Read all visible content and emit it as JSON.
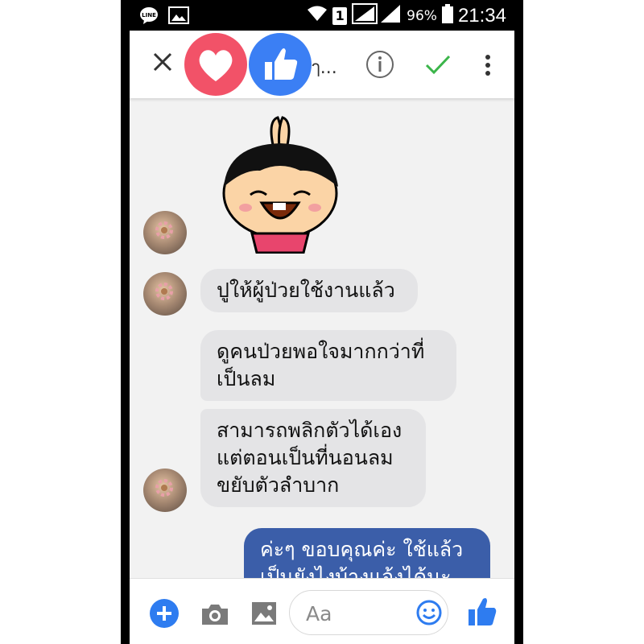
{
  "status_bar": {
    "sim_label": "1",
    "battery": "96%",
    "time": "21:34",
    "icons": [
      "line-app-icon",
      "gallery-notification-icon",
      "wifi-icon",
      "signal-icon",
      "battery-icon"
    ]
  },
  "top_bar": {
    "name_truncated": "ๅ...",
    "icons": [
      "close-icon",
      "heart-reaction-icon",
      "like-reaction-icon",
      "info-icon",
      "check-icon",
      "more-icon"
    ]
  },
  "messages": [
    {
      "from": "other",
      "text": "ปูให้ผู้ป่วยใช้งานแล้ว"
    },
    {
      "from": "other",
      "text": "ดูคนป่วยพอใจมากกว่าที่\nเป็นลม"
    },
    {
      "from": "other",
      "text": "สามารถพลิกตัวได้เอง\nแต่ตอนเป็นที่นอนลม\nขยับตัวลำบาก"
    },
    {
      "from": "me",
      "text": "ค่ะๆ ขอบคุณค่ะ ใช้แล้ว\nเป็นยังไงบ้างแจ้งได้นะ"
    }
  ],
  "composer": {
    "placeholder": "Aa",
    "icons": [
      "plus-icon",
      "camera-icon",
      "gallery-icon",
      "emoji-icon",
      "thumbs-up-icon"
    ]
  },
  "colors": {
    "accent": "#3b7ff4",
    "heart": "#f25268",
    "my_bubble": "#3b5ea9",
    "their_bubble": "#e4e4e6",
    "check": "#3bb54a"
  }
}
